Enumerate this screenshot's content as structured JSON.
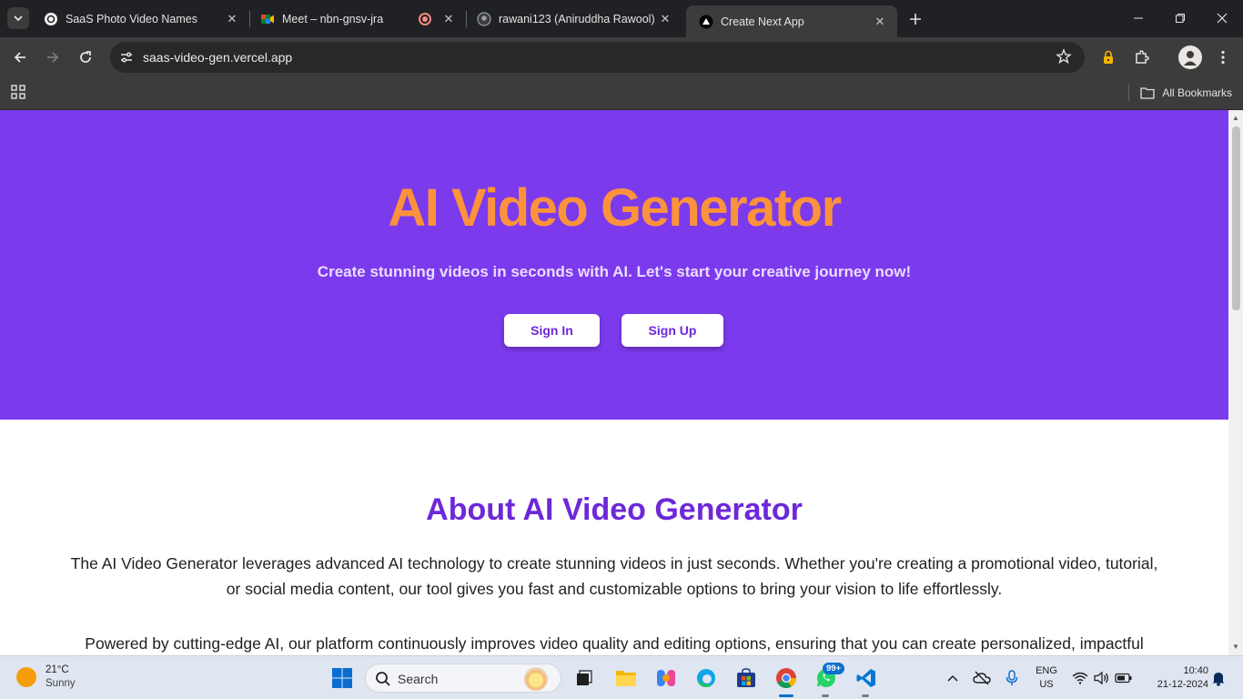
{
  "tabs": [
    {
      "title": "SaaS Photo Video Names",
      "active": false
    },
    {
      "title": "Meet – nbn-gnsv-jra",
      "active": false,
      "recording": true
    },
    {
      "title": "rawani123 (Aniruddha Rawool)",
      "active": false
    },
    {
      "title": "Create Next App",
      "active": true
    }
  ],
  "address_bar": {
    "url": "saas-video-gen.vercel.app"
  },
  "bookmarks": {
    "all_bookmarks_label": "All Bookmarks"
  },
  "hero": {
    "title": "AI Video Generator",
    "subtitle": "Create stunning videos in seconds with AI. Let's start your creative journey now!",
    "sign_in_label": "Sign In",
    "sign_up_label": "Sign Up"
  },
  "about": {
    "title": "About AI Video Generator",
    "paragraph1_line1": "The AI Video Generator leverages advanced AI technology to create stunning videos in just seconds. Whether you're creating a promotional video, tutorial,",
    "paragraph1_line2": "or social media content, our tool gives you fast and customizable options to bring your vision to life effortlessly.",
    "paragraph2_line1": "Powered by cutting-edge AI, our platform continuously improves video quality and editing options, ensuring that you can create personalized, impactful"
  },
  "taskbar": {
    "weather_temp": "21°C",
    "weather_desc": "Sunny",
    "search_label": "Search",
    "whatsapp_badge": "99+",
    "language_line1": "ENG",
    "language_line2": "US",
    "time": "10:40",
    "date": "21-12-2024"
  },
  "colors": {
    "hero_bg": "#7c3aed",
    "hero_title": "#fb923c",
    "about_title": "#6d28d9"
  }
}
